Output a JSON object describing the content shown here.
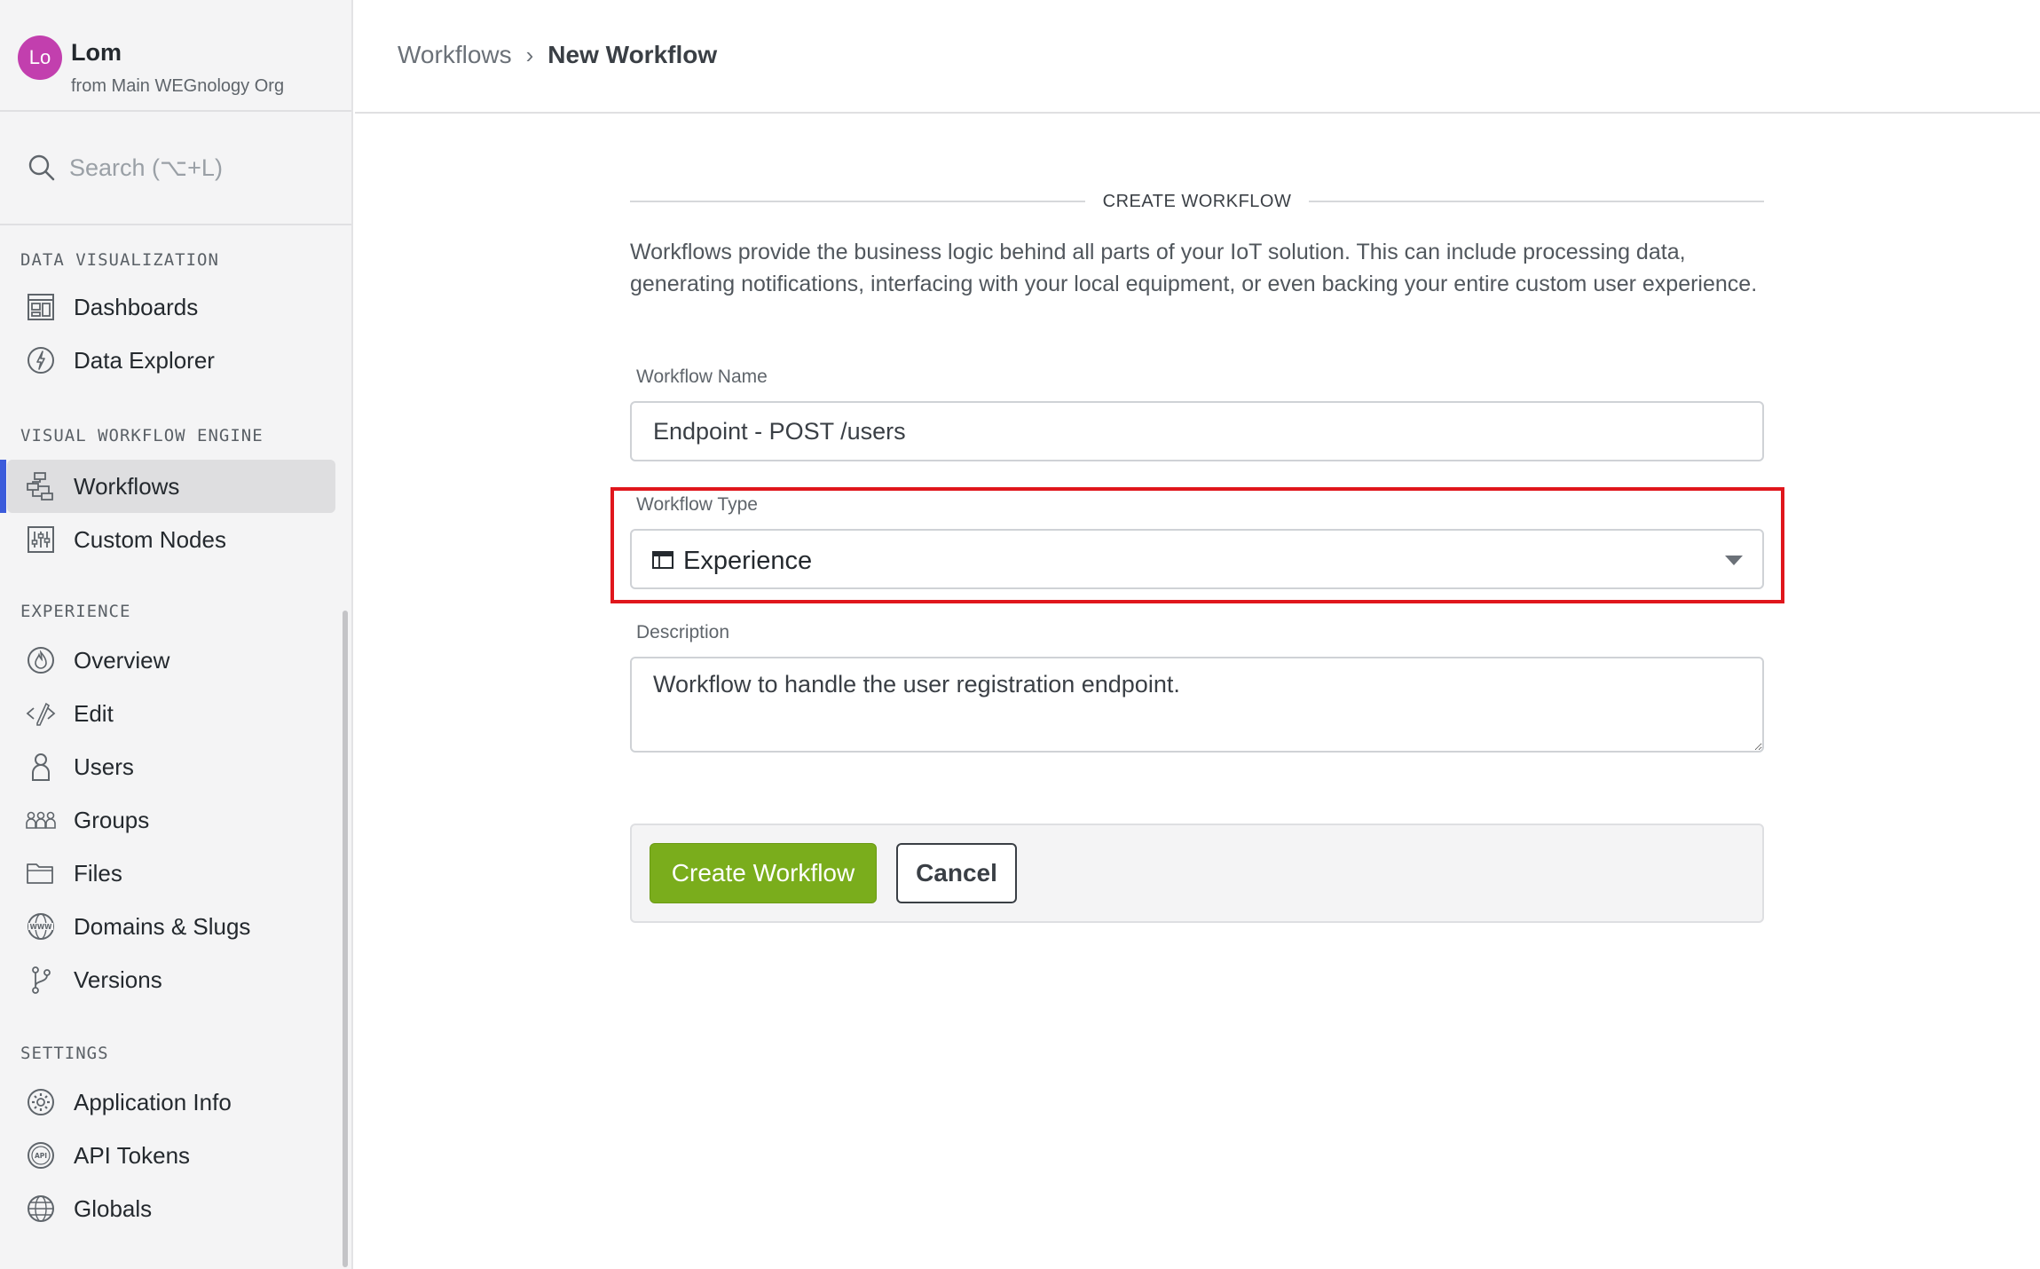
{
  "org": {
    "avatar_initials": "Lo",
    "avatar_color": "#c23fae",
    "name": "Lom",
    "subtitle": "from Main WEGnology Org"
  },
  "search": {
    "placeholder": "Search (⌥+L)"
  },
  "sidebar": {
    "sections": [
      {
        "label": "DATA VISUALIZATION",
        "items": [
          {
            "label": "Dashboards",
            "icon": "dashboard-icon"
          },
          {
            "label": "Data Explorer",
            "icon": "data-explorer-icon"
          }
        ]
      },
      {
        "label": "VISUAL WORKFLOW ENGINE",
        "items": [
          {
            "label": "Workflows",
            "icon": "workflow-icon",
            "active": true
          },
          {
            "label": "Custom Nodes",
            "icon": "custom-nodes-icon"
          }
        ]
      },
      {
        "label": "EXPERIENCE",
        "items": [
          {
            "label": "Overview",
            "icon": "overview-icon"
          },
          {
            "label": "Edit",
            "icon": "code-edit-icon"
          },
          {
            "label": "Users",
            "icon": "user-icon"
          },
          {
            "label": "Groups",
            "icon": "groups-icon"
          },
          {
            "label": "Files",
            "icon": "folder-icon"
          },
          {
            "label": "Domains & Slugs",
            "icon": "www-globe-icon"
          },
          {
            "label": "Versions",
            "icon": "branch-icon"
          }
        ]
      },
      {
        "label": "SETTINGS",
        "items": [
          {
            "label": "Application Info",
            "icon": "gear-icon"
          },
          {
            "label": "API Tokens",
            "icon": "api-token-icon"
          },
          {
            "label": "Globals",
            "icon": "globe-icon"
          }
        ]
      }
    ]
  },
  "breadcrumb": {
    "parent": "Workflows",
    "separator": "›",
    "current": "New Workflow"
  },
  "form": {
    "section_title": "CREATE WORKFLOW",
    "intro": "Workflows provide the business logic behind all parts of your IoT solution. This can include processing data, generating notifications, interfacing with your local equipment, or even backing your entire custom user experience.",
    "name_label": "Workflow Name",
    "name_value": "Endpoint - POST /users",
    "type_label": "Workflow Type",
    "type_value": "Experience",
    "type_icon": "experience-window-icon",
    "description_label": "Description",
    "description_value": "Workflow to handle the user registration endpoint.",
    "create_label": "Create Workflow",
    "cancel_label": "Cancel"
  },
  "colors": {
    "accent_nav": "#3b5bdb",
    "primary_button": "#7aad1c",
    "highlight": "#e0161c"
  }
}
